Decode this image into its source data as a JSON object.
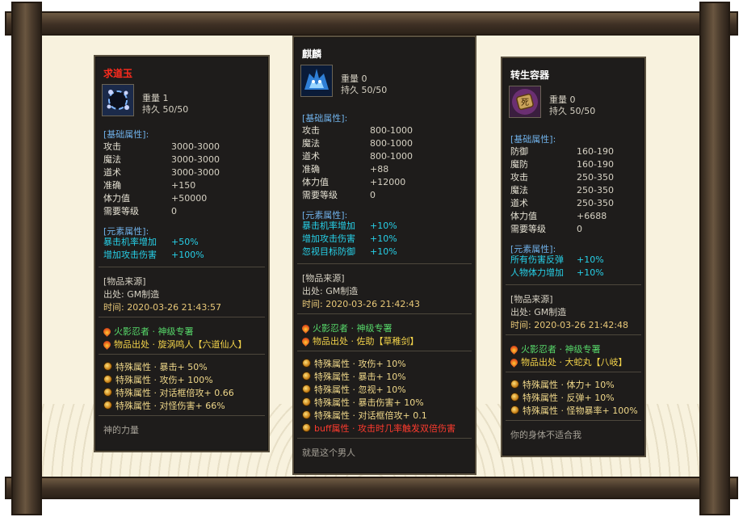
{
  "cards": [
    {
      "name": "求道玉",
      "name_color": "#ff2b1e",
      "icon": "dark-orb-icon",
      "weight": "重量  1",
      "durability": "持久  50/50",
      "base_title": "[基础属性]:",
      "base": [
        {
          "k": "攻击",
          "v": "3000-3000"
        },
        {
          "k": "魔法",
          "v": "3000-3000"
        },
        {
          "k": "道术",
          "v": "3000-3000"
        },
        {
          "k": "准确",
          "v": "+150"
        },
        {
          "k": "体力值",
          "v": "+50000"
        },
        {
          "k": "需要等级",
          "v": "0"
        }
      ],
      "elem_title": "[元素属性]:",
      "elem": [
        {
          "k": "暴击机率增加",
          "v": "+50%"
        },
        {
          "k": "增加攻击伤害",
          "v": "+100%"
        }
      ],
      "source_title": "[物品来源]",
      "source_origin": "出处: GM制造",
      "source_time": "时间: 2020-03-26 21:43:57",
      "fire_lines": [
        {
          "text": "火影忍者 · 神级专署",
          "color": "green"
        },
        {
          "text": "物品出处 · 旋涡鸣人【六道仙人】",
          "color": "yellow"
        }
      ],
      "special": [
        {
          "text": "特殊属性 · 暴击+ 50%",
          "red": false
        },
        {
          "text": "特殊属性 · 攻伤+ 100%",
          "red": false
        },
        {
          "text": "特殊属性 · 对话框倍攻+ 0.66",
          "red": false
        },
        {
          "text": "特殊属性 · 对怪伤害+ 66%",
          "red": false
        }
      ],
      "desc": "神的力量"
    },
    {
      "name": "麒麟",
      "name_color": "#ffffff",
      "icon": "qilin-icon",
      "weight": "重量  0",
      "durability": "持久  50/50",
      "base_title": "[基础属性]:",
      "base": [
        {
          "k": "攻击",
          "v": "800-1000"
        },
        {
          "k": "魔法",
          "v": "800-1000"
        },
        {
          "k": "道术",
          "v": "800-1000"
        },
        {
          "k": "准确",
          "v": "+88"
        },
        {
          "k": "体力值",
          "v": "+12000"
        },
        {
          "k": "需要等级",
          "v": "0"
        }
      ],
      "elem_title": "[元素属性]:",
      "elem": [
        {
          "k": "暴击机率增加",
          "v": "+10%"
        },
        {
          "k": "增加攻击伤害",
          "v": "+10%"
        },
        {
          "k": "忽视目标防御",
          "v": "+10%"
        }
      ],
      "source_title": "[物品来源]",
      "source_origin": "出处: GM制造",
      "source_time": "时间: 2020-03-26 21:42:43",
      "fire_lines": [
        {
          "text": "火影忍者 · 神级专署",
          "color": "green"
        },
        {
          "text": "物品出处 · 佐助【草稚剑】",
          "color": "yellow"
        }
      ],
      "special": [
        {
          "text": "特殊属性 · 攻伤+ 10%",
          "red": false
        },
        {
          "text": "特殊属性 · 暴击+ 10%",
          "red": false
        },
        {
          "text": "特殊属性 · 忽视+ 10%",
          "red": false
        },
        {
          "text": "特殊属性 · 暴击伤害+ 10%",
          "red": false
        },
        {
          "text": "特殊属性 · 对话框倍攻+ 0.1",
          "red": false
        },
        {
          "text": "buff属性 · 攻击时几率触发双倍伤害",
          "red": true
        }
      ],
      "desc": "就是这个男人"
    },
    {
      "name": "转生容器",
      "name_color": "#ffffff",
      "icon": "death-scroll-icon",
      "weight": "重量  0",
      "durability": "持久  50/50",
      "base_title": "[基础属性]:",
      "base": [
        {
          "k": "防御",
          "v": "160-190"
        },
        {
          "k": "魔防",
          "v": "160-190"
        },
        {
          "k": "攻击",
          "v": "250-350"
        },
        {
          "k": "魔法",
          "v": "250-350"
        },
        {
          "k": "道术",
          "v": "250-350"
        },
        {
          "k": "体力值",
          "v": "+6688"
        },
        {
          "k": "需要等级",
          "v": "0"
        }
      ],
      "elem_title": "[元素属性]:",
      "elem": [
        {
          "k": "所有伤害反弹",
          "v": "+10%"
        },
        {
          "k": "人物体力增加",
          "v": "+10%"
        }
      ],
      "source_title": "[物品来源]",
      "source_origin": "出处: GM制造",
      "source_time": "时间: 2020-03-26 21:42:48",
      "fire_lines": [
        {
          "text": "火影忍者 · 神级专署",
          "color": "green"
        },
        {
          "text": "物品出处 · 大蛇丸【八岐】",
          "color": "yellow"
        }
      ],
      "special": [
        {
          "text": "特殊属性 · 体力+ 10%",
          "red": false
        },
        {
          "text": "特殊属性 · 反弹+ 10%",
          "red": false
        },
        {
          "text": "特殊属性 · 怪物暴率+ 100%",
          "red": false
        }
      ],
      "desc": "你的身体不适合我"
    }
  ]
}
